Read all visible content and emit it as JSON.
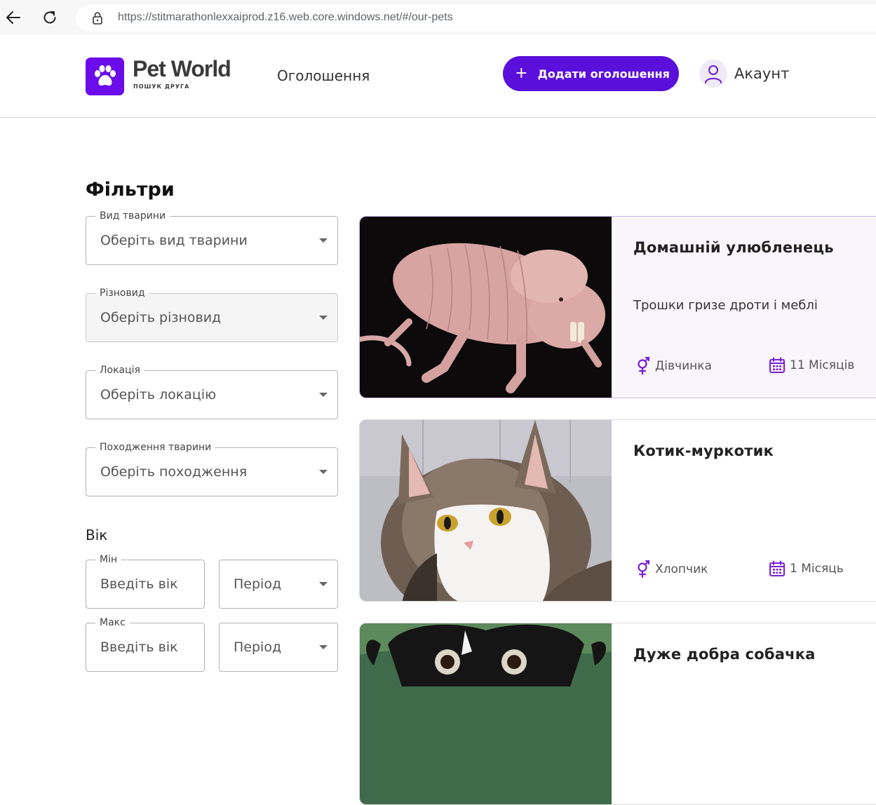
{
  "browser": {
    "url": "https://stitmarathonlexxaiprod.z16.web.core.windows.net/#/our-pets"
  },
  "header": {
    "logo_title": "Pet World",
    "logo_tagline": "ПОШУК ДРУГА",
    "nav_link": "Оголошення",
    "add_button": "Додати оголошення",
    "account": "Акаунт"
  },
  "filters": {
    "title": "Фільтри",
    "animal_type": {
      "label": "Вид тварини",
      "placeholder": "Оберіть вид тварини"
    },
    "breed": {
      "label": "Різновид",
      "placeholder": "Оберіть різновид"
    },
    "location": {
      "label": "Локація",
      "placeholder": "Оберіть локацію"
    },
    "origin": {
      "label": "Походження тварини",
      "placeholder": "Оберіть походження"
    },
    "age": {
      "title": "Вік",
      "min": {
        "label": "Мін",
        "placeholder": "Введіть вік",
        "period": "Період"
      },
      "max": {
        "label": "Макс",
        "placeholder": "Введіть вік",
        "period": "Період"
      }
    }
  },
  "pets": [
    {
      "title": "Домашній улюбленець",
      "description": "Трошки гризе дроти і меблі",
      "gender": "Дівчинка",
      "age": "11 Місяців",
      "photo": "naked-mole-rat"
    },
    {
      "title": "Котик-муркотик",
      "description": "",
      "gender": "Хлопчик",
      "age": "1 Місяць",
      "photo": "cat"
    },
    {
      "title": "Дуже добра собачка",
      "description": "",
      "gender": "",
      "age": "",
      "photo": "dog"
    }
  ],
  "colors": {
    "accent": "#5b0fdb",
    "logo": "#6a0dea",
    "icon": "#7a1fd6"
  }
}
